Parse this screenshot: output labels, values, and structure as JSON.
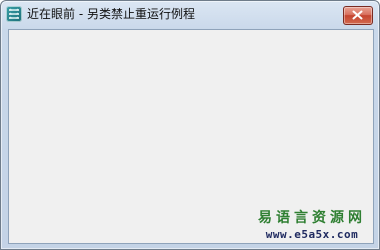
{
  "window": {
    "title": "近在眼前 - 另类禁止重运行例程",
    "icon": "app-icon",
    "close_icon": "close-icon"
  },
  "watermark": {
    "name": "易语言资源网",
    "url": "www.e5a5x.com",
    "name_color": "#2f7f32",
    "url_color": "#1f2a60"
  },
  "colors": {
    "client_background": "#f0f0f0",
    "close_button": "#c5442f"
  }
}
